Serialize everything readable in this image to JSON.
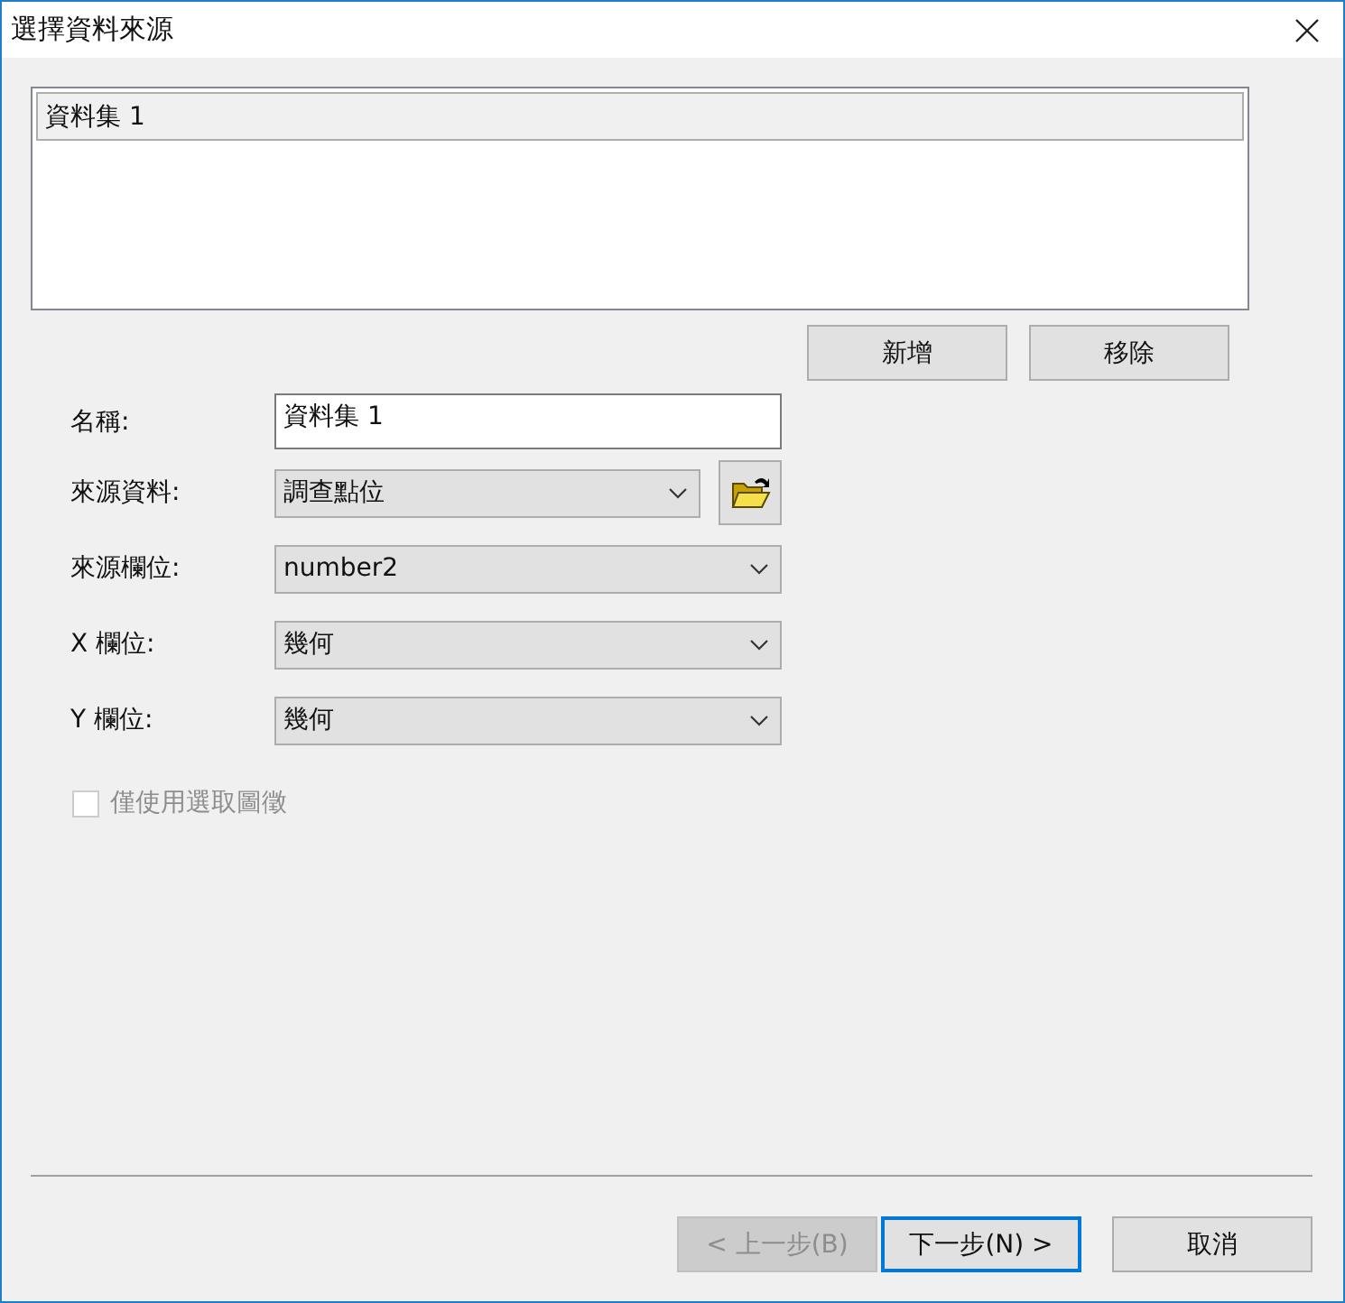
{
  "window": {
    "title": "選擇資料來源"
  },
  "datasets": [
    {
      "label": "資料集 1",
      "selected": true
    }
  ],
  "list_buttons": [
    "新增",
    "移除"
  ],
  "fields": [
    {
      "kind": "text",
      "label": "名稱:",
      "value": "資料集 1"
    },
    {
      "kind": "select_browse",
      "label": "來源資料:",
      "value": "調查點位"
    },
    {
      "kind": "select",
      "label": "來源欄位:",
      "value": "number2"
    },
    {
      "kind": "select",
      "label": "X 欄位:",
      "value": "幾何"
    },
    {
      "kind": "select",
      "label": "Y 欄位:",
      "value": "幾何"
    }
  ],
  "option": {
    "label": "僅使用選取圖徵",
    "checked": false,
    "disabled": true
  },
  "footer_buttons": [
    {
      "label": "< 上一步(B)",
      "disabled": true,
      "default": false
    },
    {
      "label": "下一步(N) >",
      "disabled": false,
      "default": true
    },
    {
      "label": "取消",
      "disabled": false,
      "default": false
    }
  ]
}
